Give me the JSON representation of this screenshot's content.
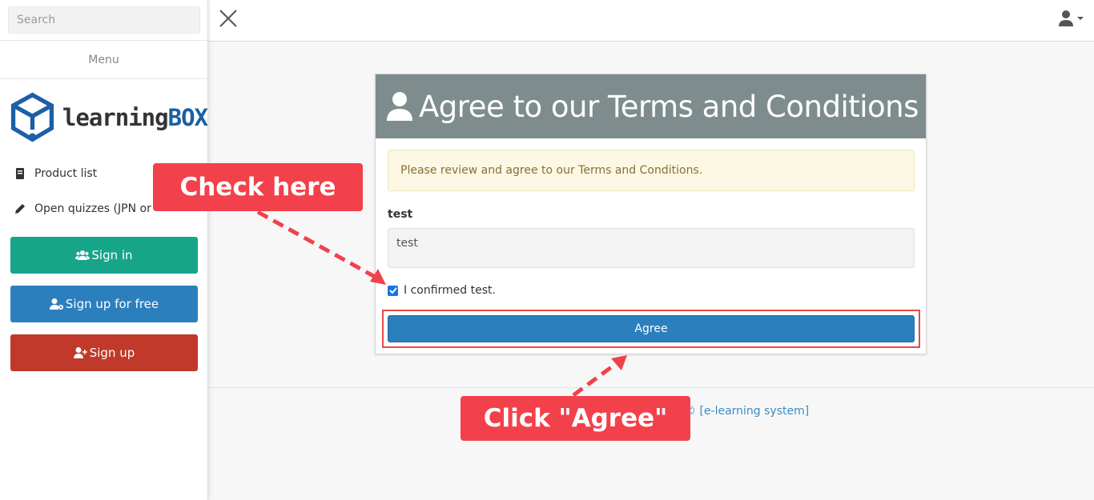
{
  "sidebar": {
    "search_placeholder": "Search",
    "menu_label": "Menu",
    "logo": {
      "word1": "learning",
      "word2": "BOX"
    },
    "nav_items": [
      {
        "label": "Product list",
        "icon": "book-icon"
      },
      {
        "label": "Open quizzes (JPN or",
        "icon": "pencil-icon"
      }
    ],
    "buttons": [
      {
        "label": "Sign in",
        "icon": "users-icon",
        "color": "#17a58a"
      },
      {
        "label": "Sign up for free",
        "icon": "user-cog-icon",
        "color": "#2c7fbd"
      },
      {
        "label": "Sign up",
        "icon": "user-plus-icon",
        "color": "#c0392b"
      }
    ]
  },
  "topbar": {
    "close_icon": "close-icon",
    "user_icon": "user-icon"
  },
  "card": {
    "title": "Agree to our Terms and Conditions",
    "alert_text": "Please review and agree to our Terms and Conditions.",
    "field_label": "test",
    "terms_text": "test",
    "checkbox_label": "I confirmed test.",
    "checkbox_checked": true,
    "agree_label": "Agree",
    "header_color": "#7f8c8d"
  },
  "footer": {
    "link_text": "© [e-learning system]"
  },
  "annotations": {
    "check_here": "Check here",
    "click_agree": "Click \"Agree\"",
    "color": "#f2414b"
  }
}
